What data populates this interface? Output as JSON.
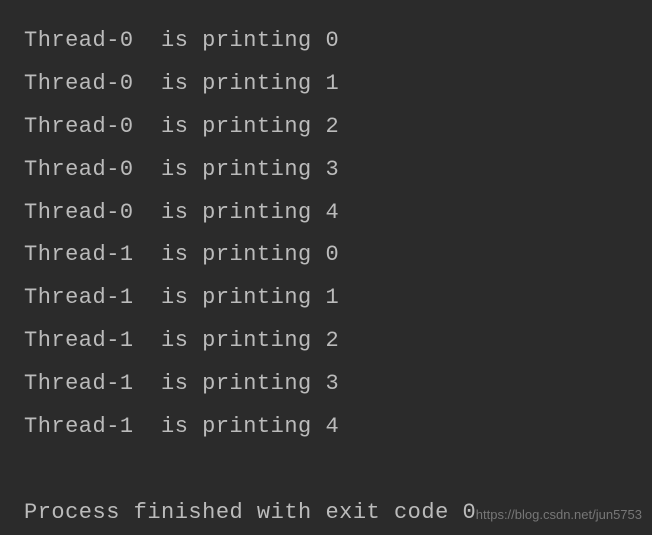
{
  "console": {
    "lines": [
      "Thread-0  is printing 0",
      "Thread-0  is printing 1",
      "Thread-0  is printing 2",
      "Thread-0  is printing 3",
      "Thread-0  is printing 4",
      "Thread-1  is printing 0",
      "Thread-1  is printing 1",
      "Thread-1  is printing 2",
      "Thread-1  is printing 3",
      "Thread-1  is printing 4"
    ],
    "final": "Process finished with exit code 0"
  },
  "watermark": "https://blog.csdn.net/jun5753"
}
